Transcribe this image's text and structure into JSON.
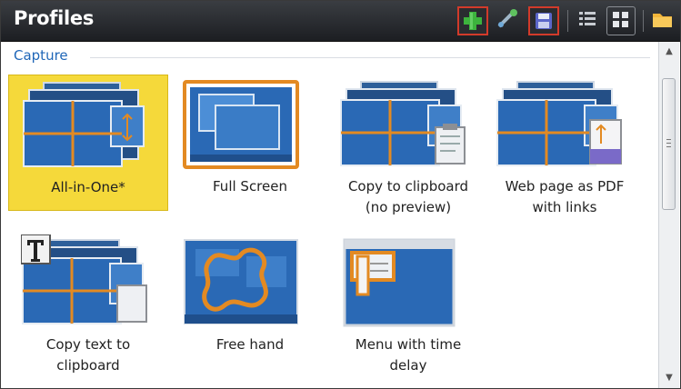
{
  "panel": {
    "title": "Profiles",
    "toolbar": [
      {
        "name": "add-profile-button",
        "icon": "plus-icon",
        "highlighted": true
      },
      {
        "name": "edit-profile-button",
        "icon": "wand-icon",
        "highlighted": false
      },
      {
        "name": "save-profile-button",
        "icon": "floppy-disk-icon",
        "highlighted": true
      },
      {
        "name": "list-view-button",
        "icon": "list-icon",
        "highlighted": false
      },
      {
        "name": "tile-view-button",
        "icon": "tiles-icon",
        "highlighted": false
      },
      {
        "name": "open-folder-button",
        "icon": "folder-icon",
        "highlighted": false
      }
    ]
  },
  "group": {
    "header": "Capture",
    "items": [
      {
        "label_lines": [
          "All-in-One*"
        ],
        "selected": true,
        "icon": "all-in-one-icon"
      },
      {
        "label_lines": [
          "Full Screen"
        ],
        "selected": false,
        "icon": "full-screen-icon"
      },
      {
        "label_lines": [
          "Copy to clipboard",
          "(no preview)"
        ],
        "selected": false,
        "icon": "clipboard-icon"
      },
      {
        "label_lines": [
          "Web page as PDF",
          "with links"
        ],
        "selected": false,
        "icon": "web-pdf-icon"
      },
      {
        "label_lines": [
          "Copy text to",
          "clipboard"
        ],
        "selected": false,
        "icon": "text-capture-icon"
      },
      {
        "label_lines": [
          "Free hand"
        ],
        "selected": false,
        "icon": "free-hand-icon"
      },
      {
        "label_lines": [
          "Menu with time",
          "delay"
        ],
        "selected": false,
        "icon": "menu-delay-icon"
      }
    ]
  },
  "colors": {
    "selection": "#f5d93a",
    "header_text": "#1f66b8",
    "title_bar": "#2a2c30",
    "highlight_border": "#d23a2a",
    "capture_orange": "#e38a22"
  }
}
